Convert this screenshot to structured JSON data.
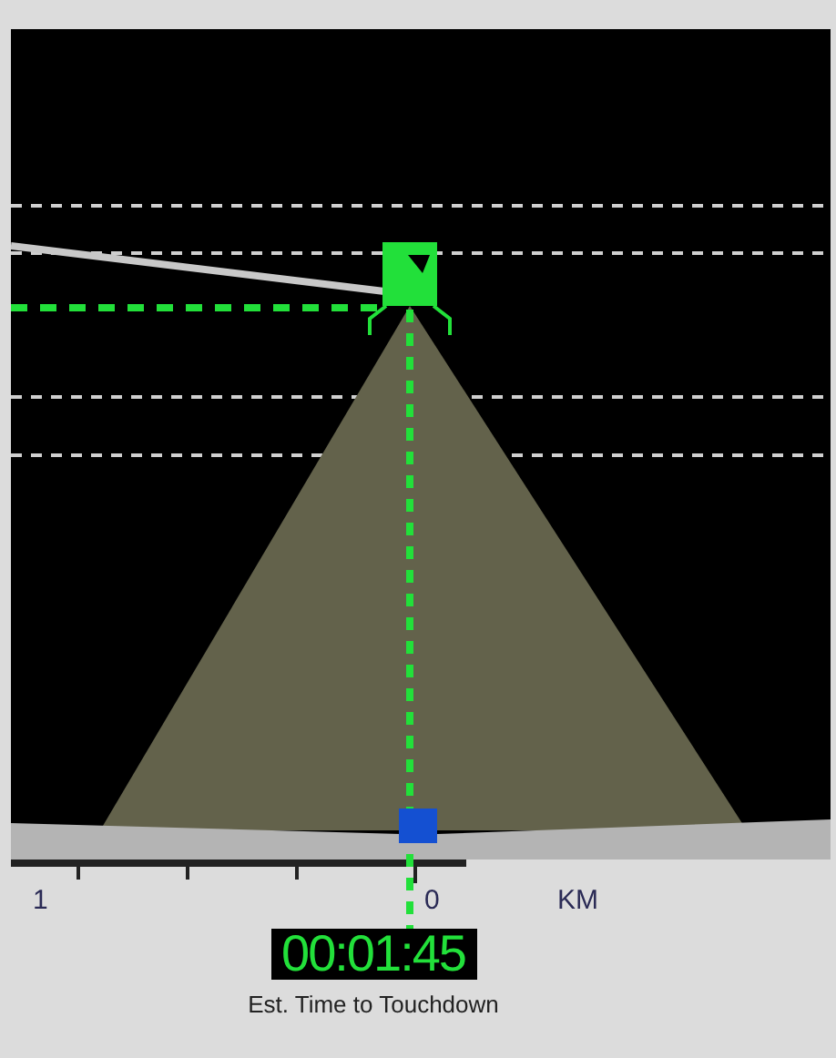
{
  "scale": {
    "labels": [
      {
        "text": "1"
      },
      {
        "text": "0"
      },
      {
        "text": "KM"
      }
    ]
  },
  "timer": {
    "value": "00:01:45",
    "caption": "Est. Time to Touchdown"
  }
}
